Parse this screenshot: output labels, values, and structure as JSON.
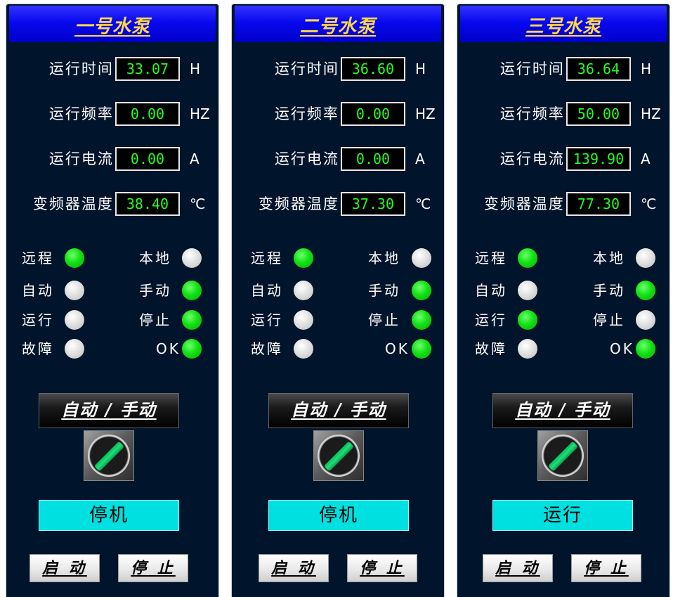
{
  "pumps": [
    {
      "title": "一号水泵",
      "rows": [
        {
          "label": "运行时间:",
          "value": "33.07",
          "unit": "H"
        },
        {
          "label": "运行频率:",
          "value": "0.00",
          "unit": "HZ"
        },
        {
          "label": "运行电流:",
          "value": "0.00",
          "unit": "A"
        },
        {
          "label": "变频器温度:",
          "value": "38.40",
          "unit": "℃"
        }
      ],
      "indicators": {
        "remote": {
          "label": "远程",
          "on": true
        },
        "local": {
          "label": "本地",
          "on": false
        },
        "auto": {
          "label": "自动",
          "on": false
        },
        "manual": {
          "label": "手动",
          "on": true
        },
        "running": {
          "label": "运行",
          "on": false
        },
        "stopped": {
          "label": "停止",
          "on": true
        },
        "fault": {
          "label": "故障",
          "on": false
        },
        "ok": {
          "label": "OK",
          "on": true
        }
      },
      "mode_label": "自动 / 手动",
      "status": "停机",
      "start_label": "启 动",
      "stop_label": "停 止"
    },
    {
      "title": "二号水泵",
      "rows": [
        {
          "label": "运行时间:",
          "value": "36.60",
          "unit": "H"
        },
        {
          "label": "运行频率:",
          "value": "0.00",
          "unit": "HZ"
        },
        {
          "label": "运行电流:",
          "value": "0.00",
          "unit": "A"
        },
        {
          "label": "变频器温度:",
          "value": "37.30",
          "unit": "℃"
        }
      ],
      "indicators": {
        "remote": {
          "label": "远程",
          "on": true
        },
        "local": {
          "label": "本地",
          "on": false
        },
        "auto": {
          "label": "自动",
          "on": false
        },
        "manual": {
          "label": "手动",
          "on": true
        },
        "running": {
          "label": "运行",
          "on": false
        },
        "stopped": {
          "label": "停止",
          "on": true
        },
        "fault": {
          "label": "故障",
          "on": false
        },
        "ok": {
          "label": "OK",
          "on": true
        }
      },
      "mode_label": "自动 / 手动",
      "status": "停机",
      "start_label": "启 动",
      "stop_label": "停 止"
    },
    {
      "title": "三号水泵",
      "rows": [
        {
          "label": "运行时间:",
          "value": "36.64",
          "unit": "H"
        },
        {
          "label": "运行频率:",
          "value": "50.00",
          "unit": "HZ"
        },
        {
          "label": "运行电流:",
          "value": "139.90",
          "unit": "A"
        },
        {
          "label": "变频器温度:",
          "value": "77.30",
          "unit": "℃"
        }
      ],
      "indicators": {
        "remote": {
          "label": "远程",
          "on": true
        },
        "local": {
          "label": "本地",
          "on": false
        },
        "auto": {
          "label": "自动",
          "on": false
        },
        "manual": {
          "label": "手动",
          "on": true
        },
        "running": {
          "label": "运行",
          "on": true
        },
        "stopped": {
          "label": "停止",
          "on": false
        },
        "fault": {
          "label": "故障",
          "on": false
        },
        "ok": {
          "label": "OK",
          "on": true
        }
      },
      "mode_label": "自动 / 手动",
      "status": "运行",
      "start_label": "启 动",
      "stop_label": "停 止"
    }
  ],
  "colors": {
    "panel_bg": "#00142b",
    "header_blue": "#0808f0",
    "title_yellow": "#ffd84a",
    "value_green": "#22ff22",
    "lamp_on": "#14e014",
    "lamp_off": "#dedede",
    "status_cyan": "#00e0e0"
  },
  "icons": {
    "lamp": "indicator-lamp",
    "mode_switch": "selector-switch-icon"
  }
}
